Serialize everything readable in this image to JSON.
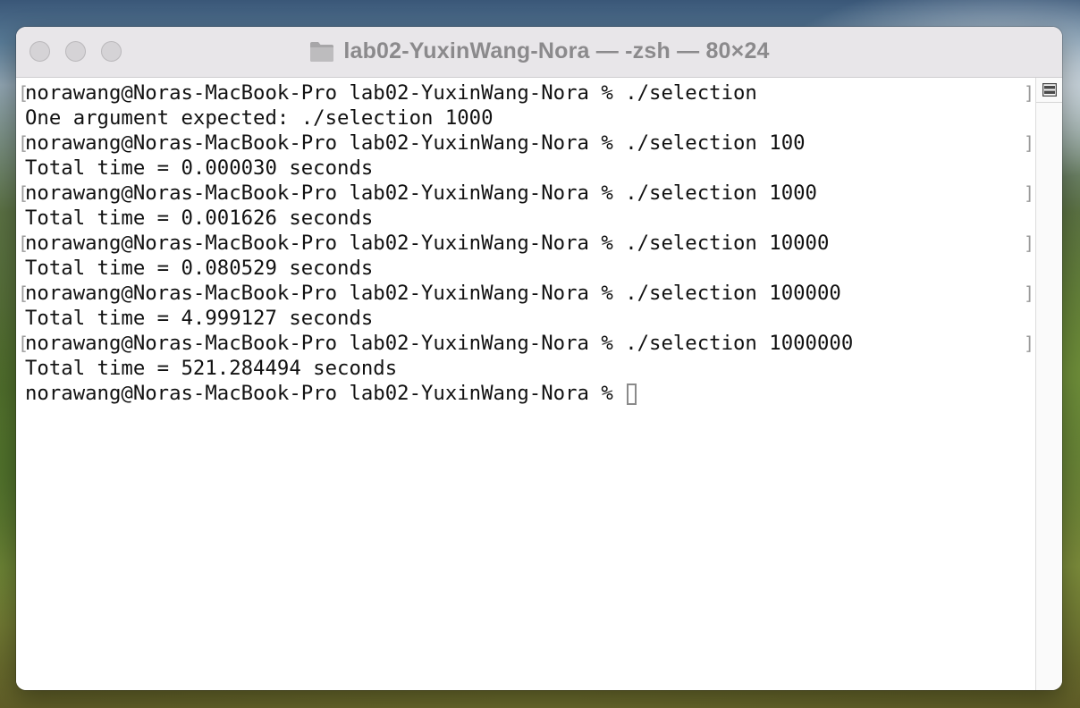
{
  "window": {
    "title": "lab02-YuxinWang-Nora — -zsh — 80×24",
    "folder_icon": "folder-icon"
  },
  "terminal": {
    "lines": [
      {
        "text": "norawang@Noras-MacBook-Pro lab02-YuxinWang-Nora % ./selection",
        "marked": true
      },
      {
        "text": "One argument expected: ./selection 1000",
        "marked": false
      },
      {
        "text": "norawang@Noras-MacBook-Pro lab02-YuxinWang-Nora % ./selection 100",
        "marked": true
      },
      {
        "text": "Total time = 0.000030 seconds",
        "marked": false
      },
      {
        "text": "norawang@Noras-MacBook-Pro lab02-YuxinWang-Nora % ./selection 1000",
        "marked": true
      },
      {
        "text": "Total time = 0.001626 seconds",
        "marked": false
      },
      {
        "text": "norawang@Noras-MacBook-Pro lab02-YuxinWang-Nora % ./selection 10000",
        "marked": true
      },
      {
        "text": "Total time = 0.080529 seconds",
        "marked": false
      },
      {
        "text": "norawang@Noras-MacBook-Pro lab02-YuxinWang-Nora % ./selection 100000",
        "marked": true
      },
      {
        "text": "Total time = 4.999127 seconds",
        "marked": false
      },
      {
        "text": "norawang@Noras-MacBook-Pro lab02-YuxinWang-Nora % ./selection 1000000",
        "marked": true
      },
      {
        "text": "Total time = 521.284494 seconds",
        "marked": false
      }
    ],
    "prompt": "norawang@Noras-MacBook-Pro lab02-YuxinWang-Nora % ",
    "mark_left": "[",
    "mark_right": "]"
  }
}
